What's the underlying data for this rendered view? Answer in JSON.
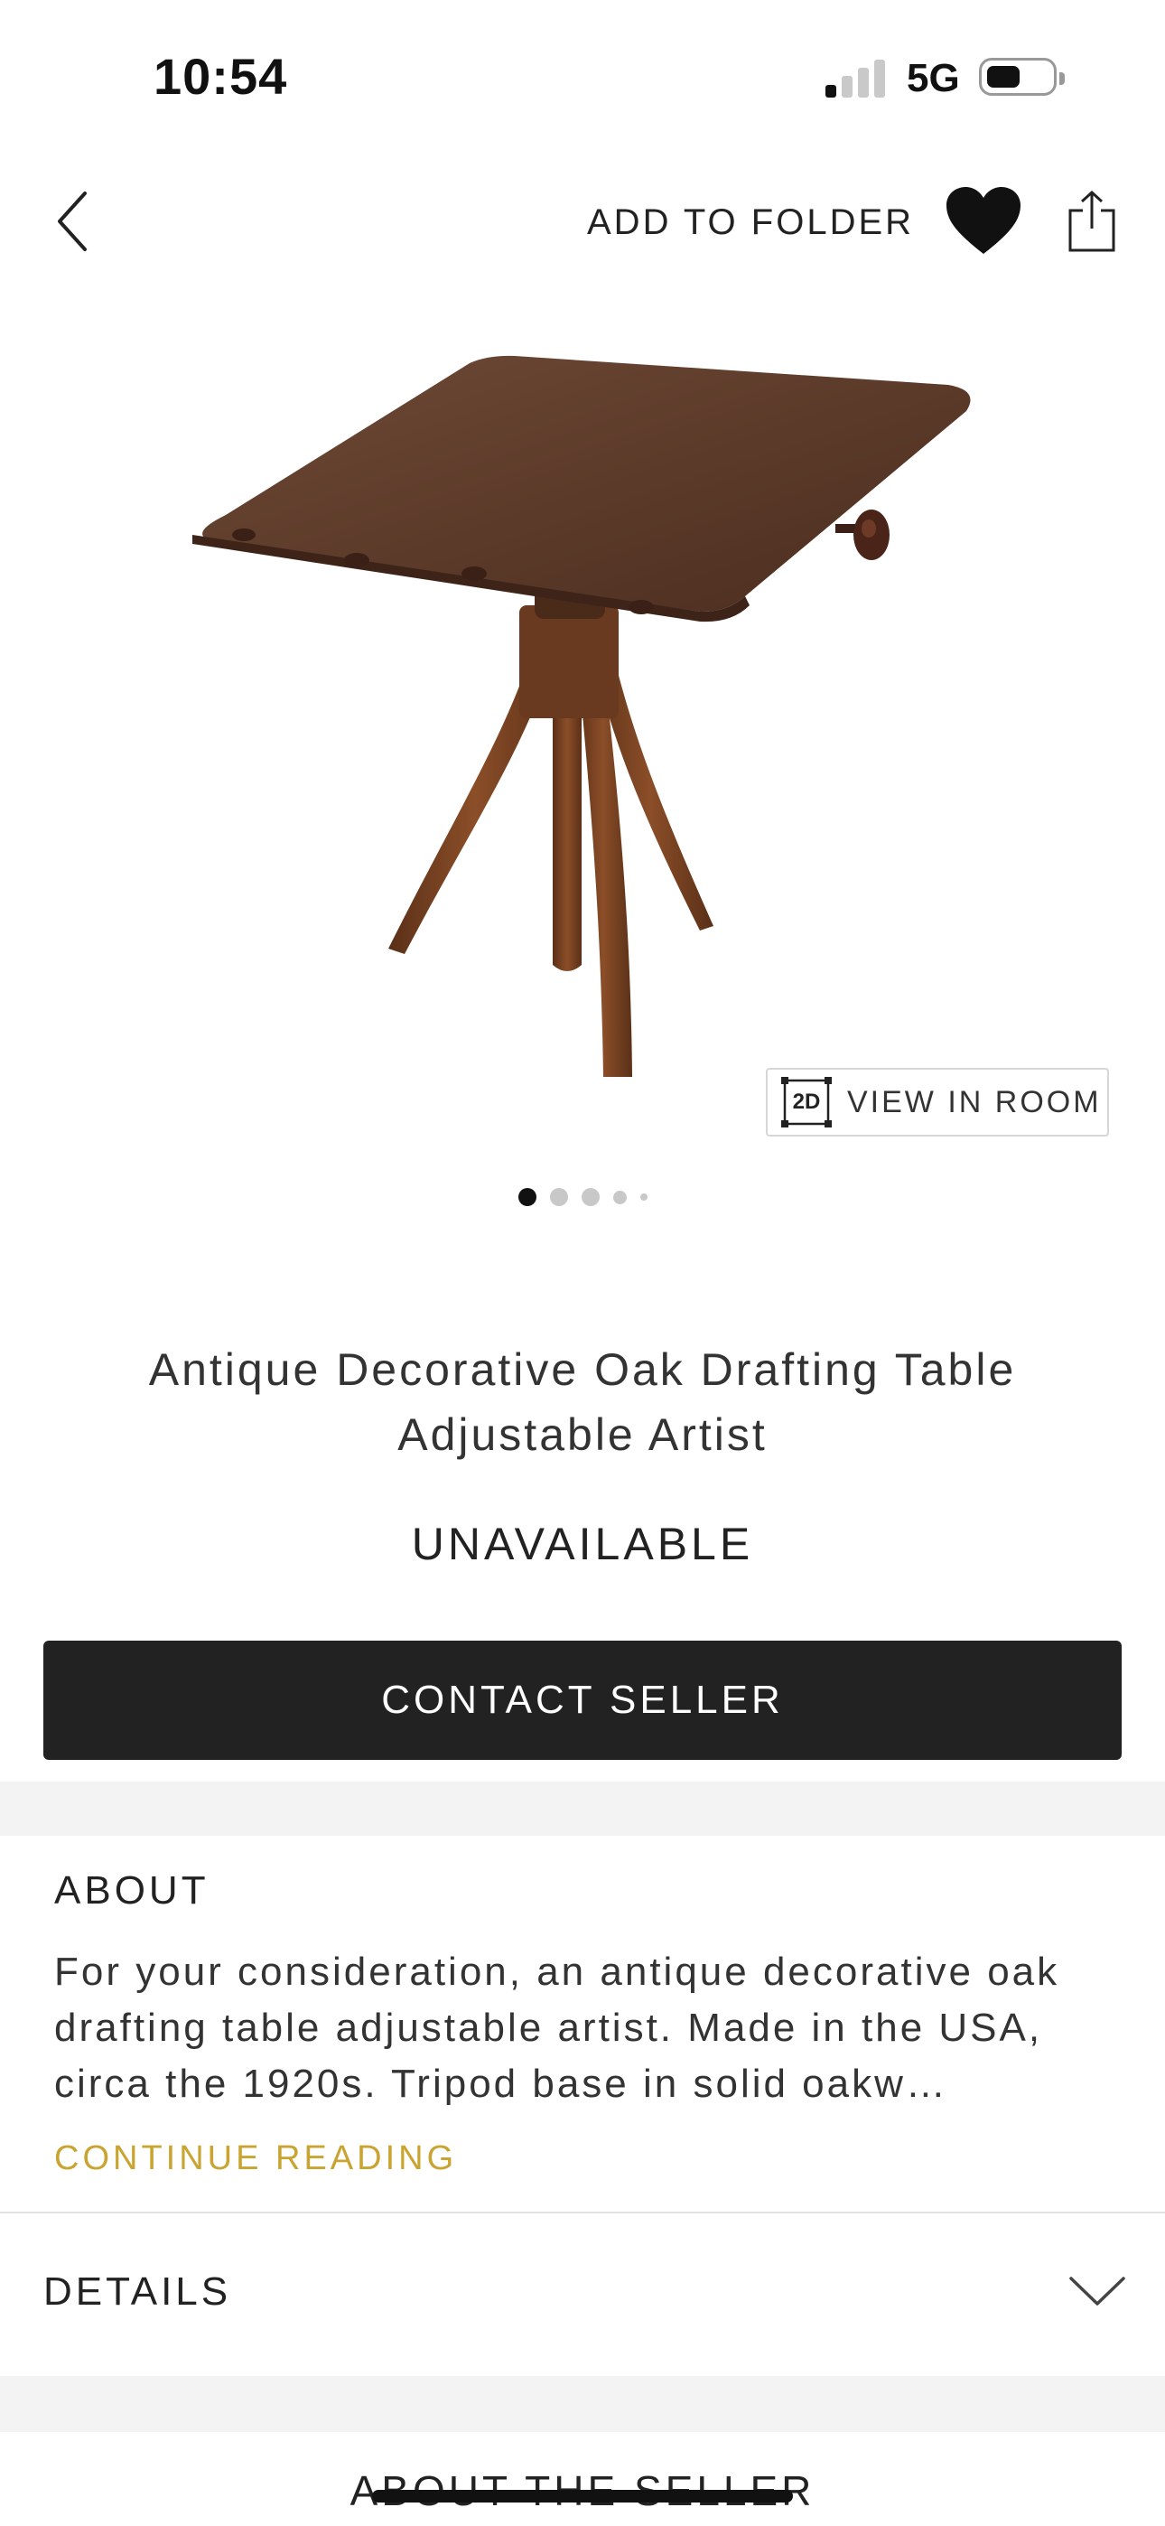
{
  "status_bar": {
    "time": "10:54",
    "network": "5G"
  },
  "nav": {
    "add_to_folder": "ADD TO FOLDER"
  },
  "gallery": {
    "view_in_room_badge": "2D",
    "view_in_room": "VIEW IN ROOM",
    "page_count": 5,
    "active_page": 1
  },
  "product": {
    "title": "Antique Decorative Oak Drafting Table Adjustable Artist",
    "availability": "UNAVAILABLE",
    "contact_button": "CONTACT SELLER"
  },
  "about": {
    "heading": "ABOUT",
    "text": "For your consideration, an antique decorative oak drafting table adjustable artist. Made in the USA, circa the 1920s. Tripod base in solid oakw…",
    "continue_reading": "CONTINUE READING"
  },
  "details": {
    "label": "DETAILS"
  },
  "seller": {
    "heading": "ABOUT THE SELLER"
  },
  "colors": {
    "accent_gold": "#c9a431",
    "button_dark": "#222222",
    "band_gray": "#f3f3f3"
  }
}
